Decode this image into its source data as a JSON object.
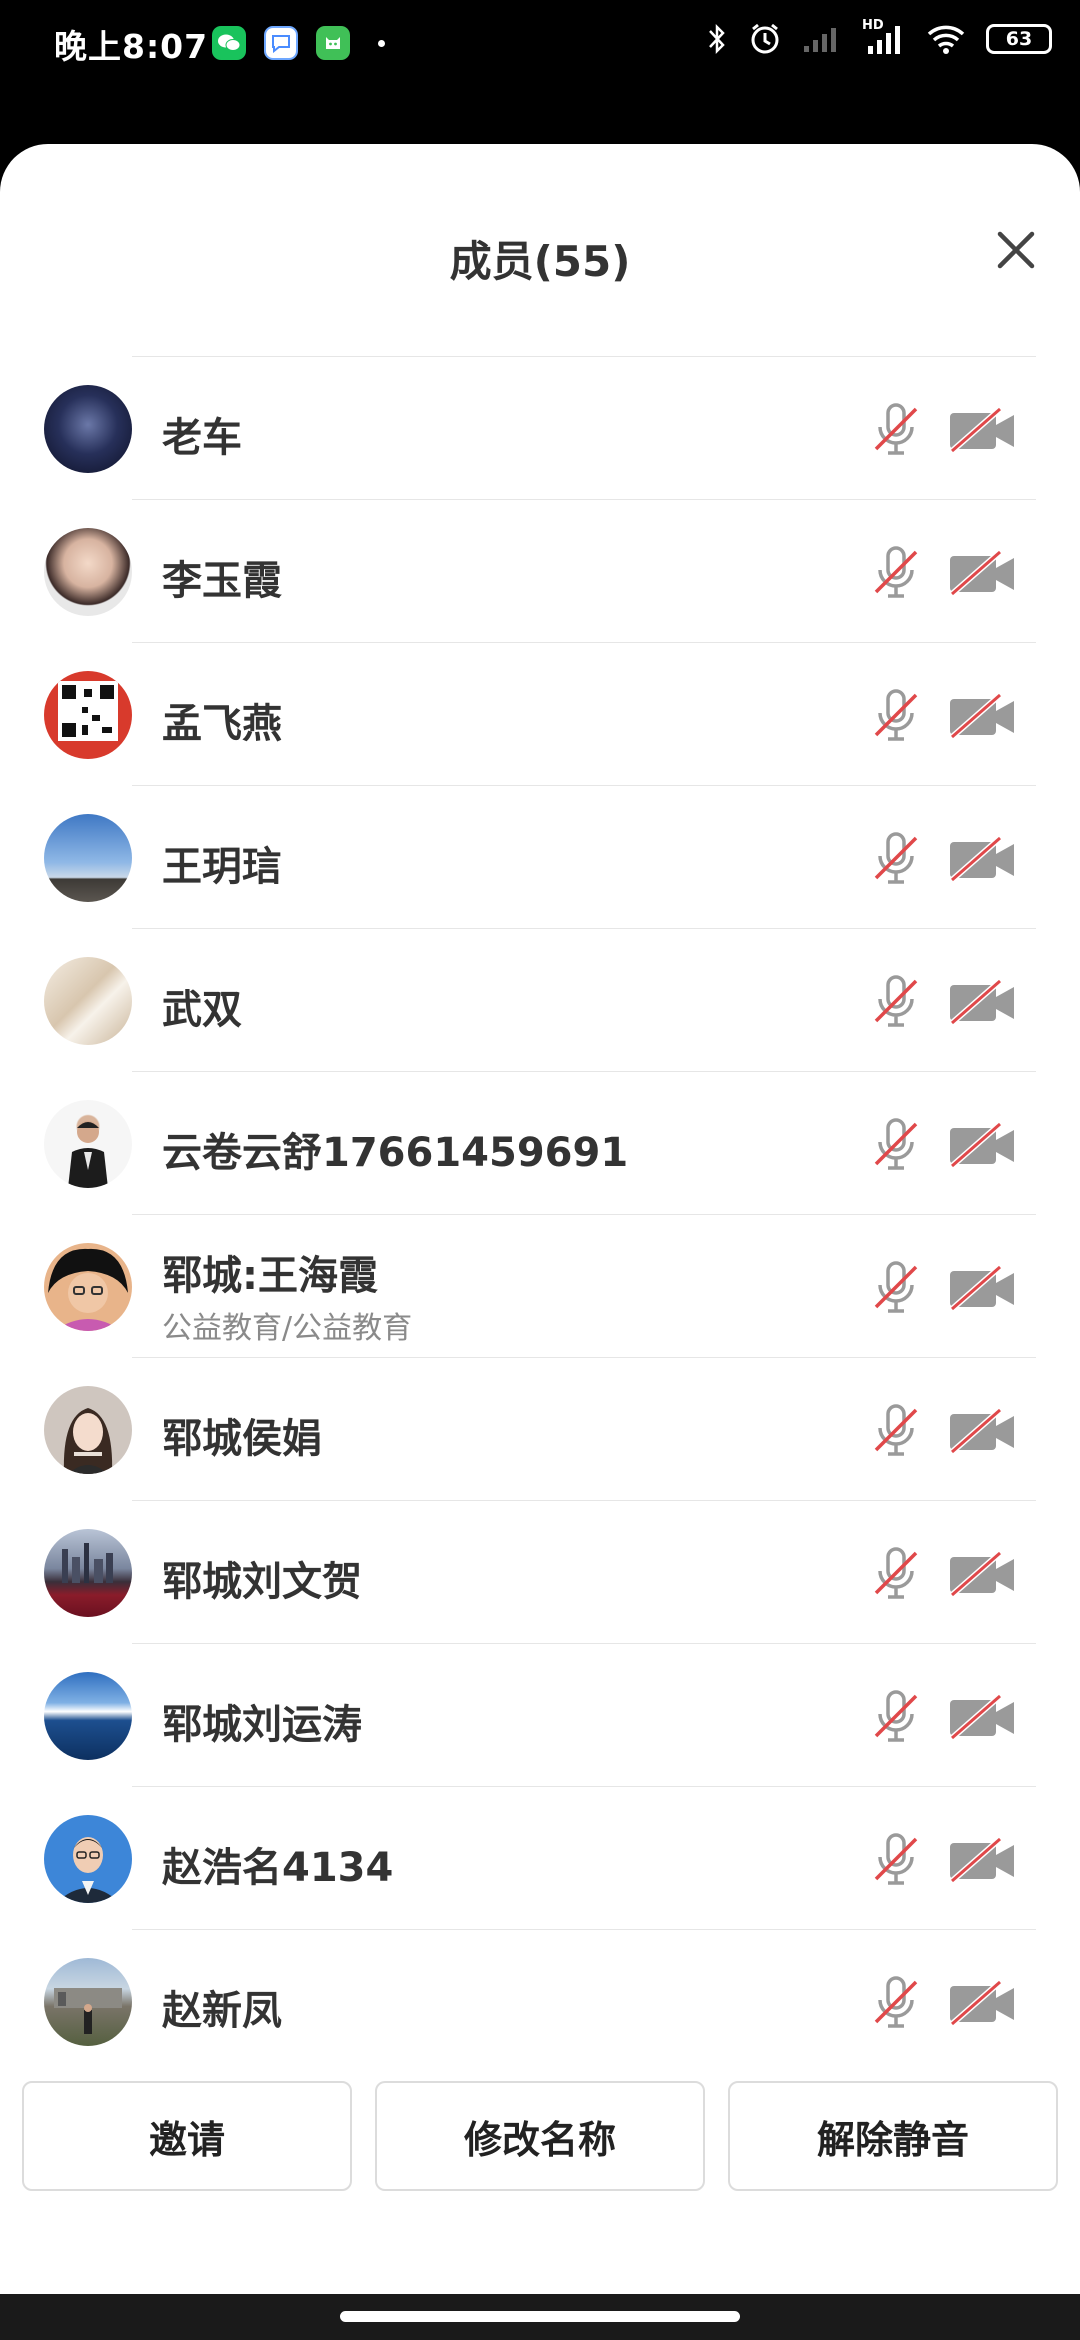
{
  "status_bar": {
    "time": "晚上8:07",
    "battery": "63",
    "hd_label": "HD"
  },
  "sheet": {
    "title": "成员(55)"
  },
  "members": [
    {
      "name": "老车",
      "subtitle": ""
    },
    {
      "name": "李玉霞",
      "subtitle": ""
    },
    {
      "name": "孟飞燕",
      "subtitle": ""
    },
    {
      "name": "王玥琂",
      "subtitle": ""
    },
    {
      "name": "武双",
      "subtitle": ""
    },
    {
      "name": "云卷云舒17661459691",
      "subtitle": ""
    },
    {
      "name": "郓城:王海霞",
      "subtitle": "公益教育/公益教育"
    },
    {
      "name": "郓城侯娟",
      "subtitle": ""
    },
    {
      "name": "郓城刘文贺",
      "subtitle": ""
    },
    {
      "name": "郓城刘运涛",
      "subtitle": ""
    },
    {
      "name": "赵浩名4134",
      "subtitle": ""
    },
    {
      "name": "赵新凤",
      "subtitle": ""
    }
  ],
  "actions": {
    "invite": "邀请",
    "rename": "修改名称",
    "unmute": "解除静音"
  },
  "colors": {
    "muted_slash": "#e0484a",
    "icon_gray": "#9a9a9a"
  }
}
